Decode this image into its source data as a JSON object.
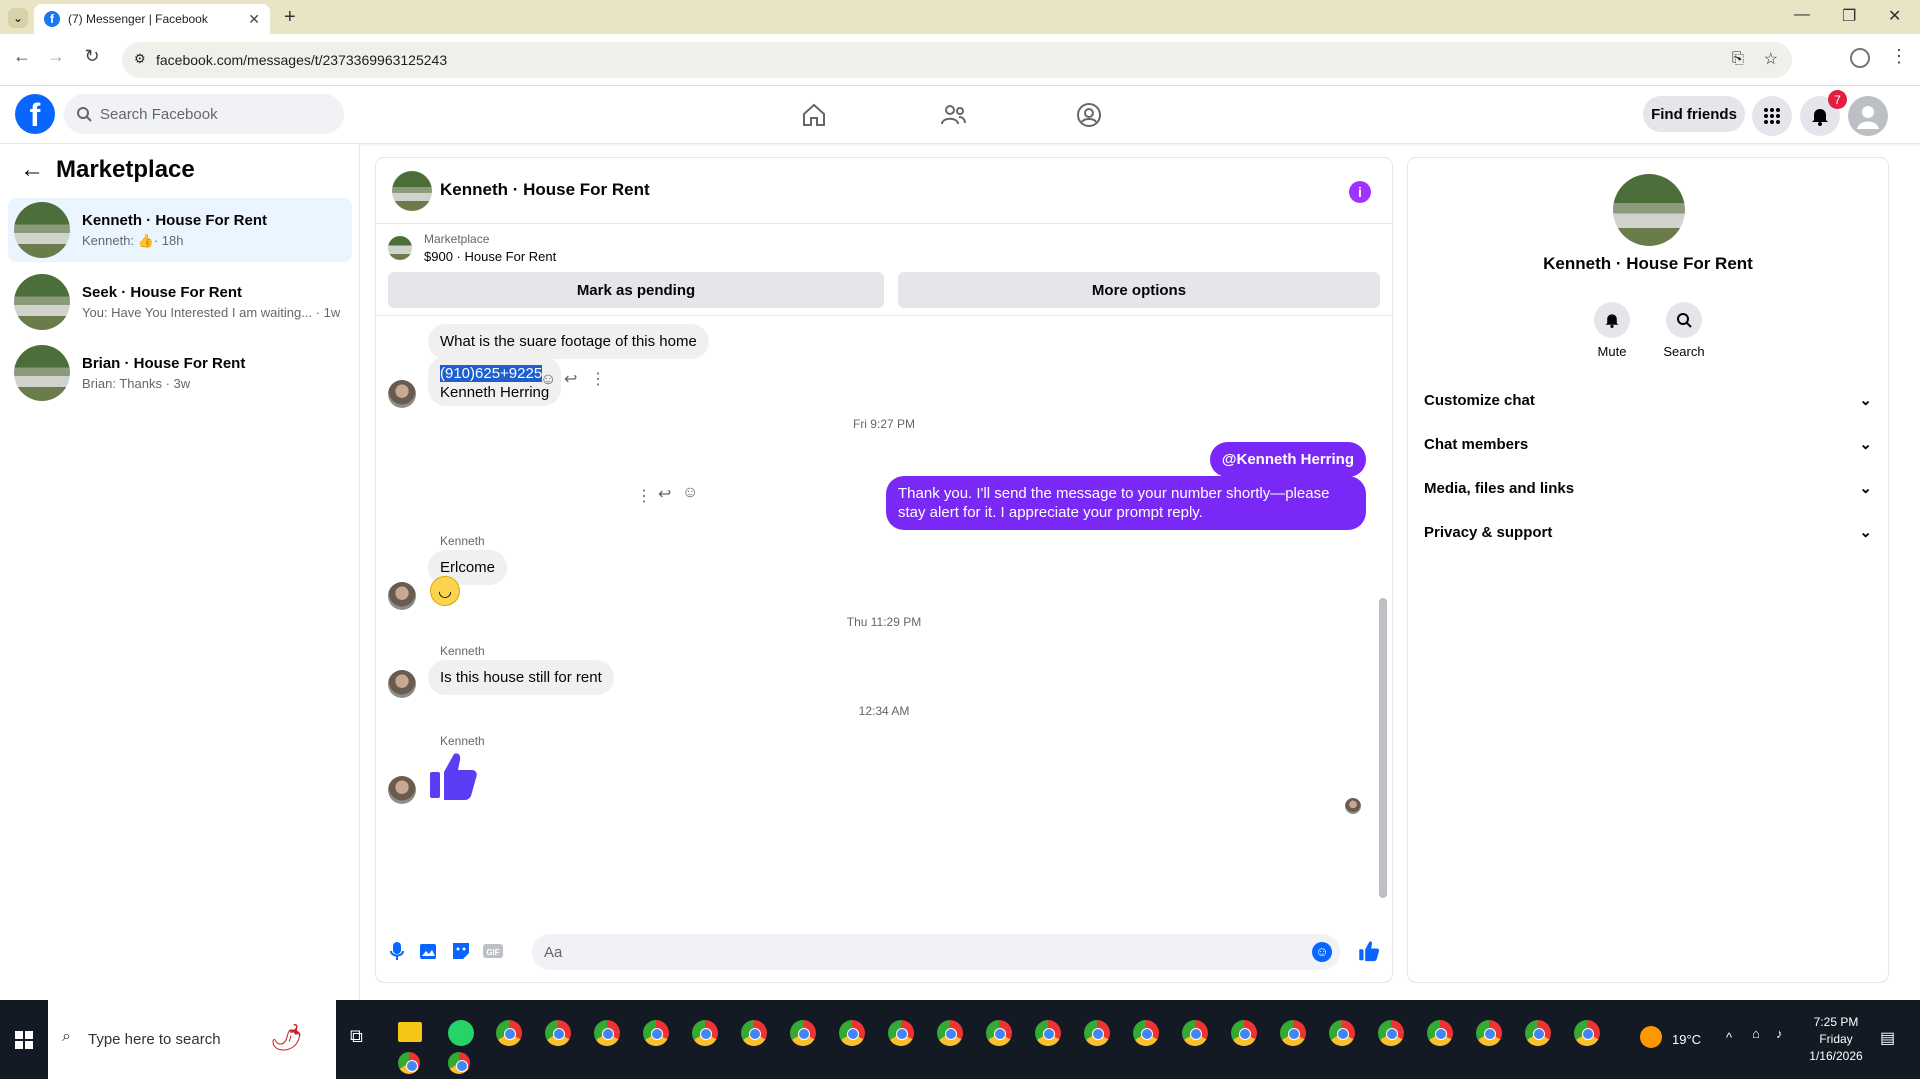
{
  "browser": {
    "tab_title": "(7) Messenger | Facebook",
    "url": "facebook.com/messages/t/2373369963125243"
  },
  "fb": {
    "search_placeholder": "Search Facebook",
    "find_friends": "Find friends",
    "notification_count": "7"
  },
  "sidebar": {
    "title": "Marketplace",
    "conversations": [
      {
        "name": "Kenneth · House For Rent",
        "preview": "Kenneth:",
        "time": "· 18h"
      },
      {
        "name": "Seek · House For Rent",
        "preview": "You: Have You Interested I am waiting... · 1w"
      },
      {
        "name": "Brian · House For Rent",
        "preview": "Brian: Thanks · 3w"
      }
    ]
  },
  "chat": {
    "title": "Kenneth · House For Rent",
    "marketplace_label": "Marketplace",
    "listing": "$900 · House For Rent",
    "mark_pending": "Mark as pending",
    "more_options": "More options",
    "messages": {
      "m1": "What is the suare footage of this home",
      "m2_selected": "(910)625+9225",
      "m2_line2": "Kenneth Herring",
      "ts1": "Fri 9:27 PM",
      "out1": "@Kenneth Herring",
      "out2": "Thank you. I'll send the message to your number shortly—please stay alert for it. I appreciate your prompt reply.",
      "sender": "Kenneth",
      "m3": "Erlcome",
      "ts2": "Thu 11:29 PM",
      "m4": "Is this house still for rent",
      "ts3": "12:34 AM"
    },
    "composer_placeholder": "Aa"
  },
  "details": {
    "name": "Kenneth · House For Rent",
    "mute": "Mute",
    "search": "Search",
    "sections": [
      "Customize chat",
      "Chat members",
      "Media, files and links",
      "Privacy & support"
    ]
  },
  "taskbar": {
    "search_placeholder": "Type here to search",
    "weather": "19°C",
    "time": "7:25 PM",
    "day": "Friday",
    "date": "1/16/2026"
  }
}
